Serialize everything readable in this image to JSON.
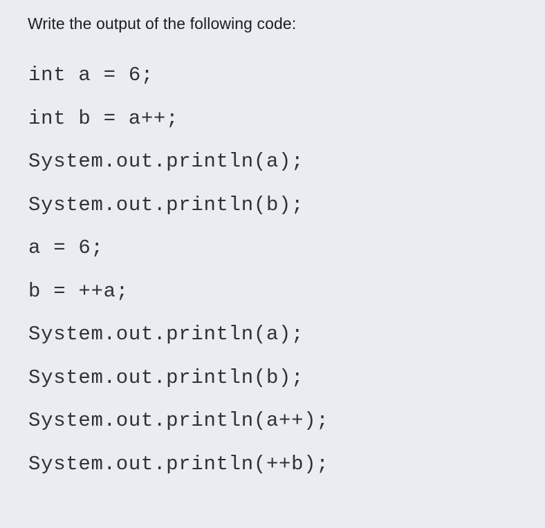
{
  "question": {
    "heading": "Write the output of the following code:",
    "language": "java",
    "code_lines": [
      "int a = 6;",
      "int b = a++;",
      "System.out.println(a);",
      "System.out.println(b);",
      "a = 6;",
      "b = ++a;",
      "System.out.println(a);",
      "System.out.println(b);",
      "System.out.println(a++);",
      "System.out.println(++b);"
    ]
  },
  "colors": {
    "background": "#eaecf1",
    "heading_text": "#1b1d26",
    "code_text": "#2f3138"
  }
}
